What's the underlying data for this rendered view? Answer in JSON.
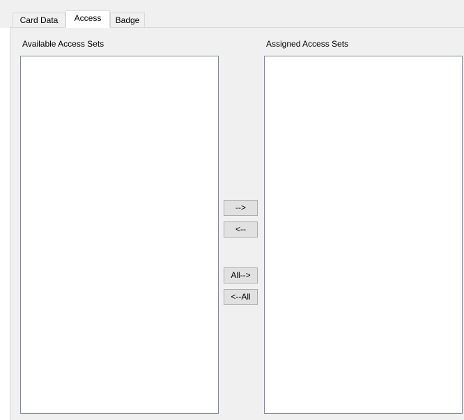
{
  "tabs": [
    {
      "label": "Card Data",
      "active": false
    },
    {
      "label": "Access",
      "active": true
    },
    {
      "label": "Badge",
      "active": false
    }
  ],
  "access_panel": {
    "available_label": "Available Access Sets",
    "assigned_label": "Assigned Access Sets",
    "available_items": [],
    "assigned_items": [],
    "buttons": {
      "add": "-->",
      "remove": "<--",
      "add_all": "All-->",
      "remove_all": "<--All"
    }
  },
  "colors": {
    "panel_background": "#f0f0f0",
    "list_background": "#ffffff",
    "list_border": "#828790",
    "button_background": "#e1e1e1",
    "button_border": "#adadad"
  }
}
